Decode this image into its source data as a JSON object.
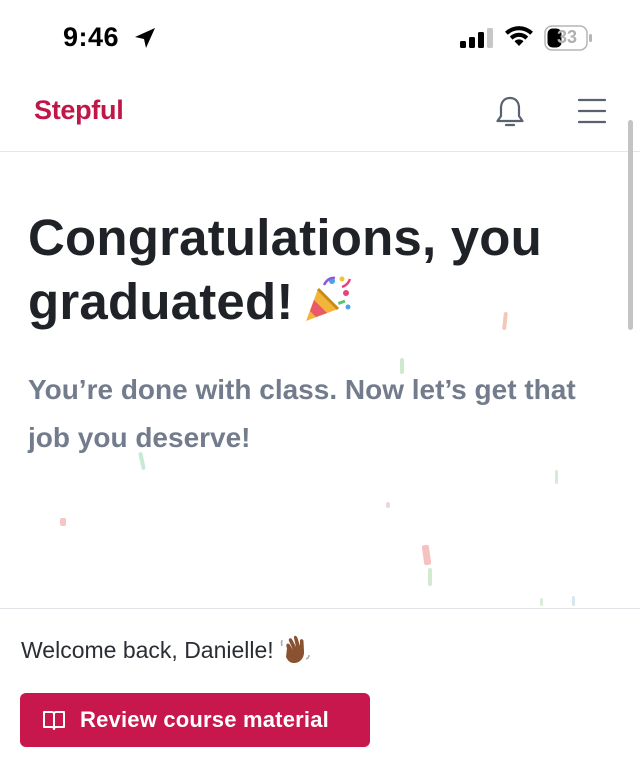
{
  "status_bar": {
    "time": "9:46",
    "battery": "33",
    "icons": [
      "location-arrow-icon",
      "cellular-signal-icon",
      "wifi-icon",
      "battery-icon"
    ]
  },
  "header": {
    "brand": "Stepful",
    "brand_color": "#c0174a",
    "icons": [
      "bell-icon",
      "hamburger-menu-icon"
    ]
  },
  "hero": {
    "title": "Congratulations, you graduated!",
    "title_icon": "party-popper-icon",
    "subtitle": "You’re done with class. Now let’s get that job you deserve!"
  },
  "footer": {
    "welcome": "Welcome back, Danielle!",
    "welcome_icon": "waving-hand-icon",
    "review_button": {
      "label": "Review course material",
      "icon": "book-open-icon",
      "color": "#c8174c"
    }
  }
}
